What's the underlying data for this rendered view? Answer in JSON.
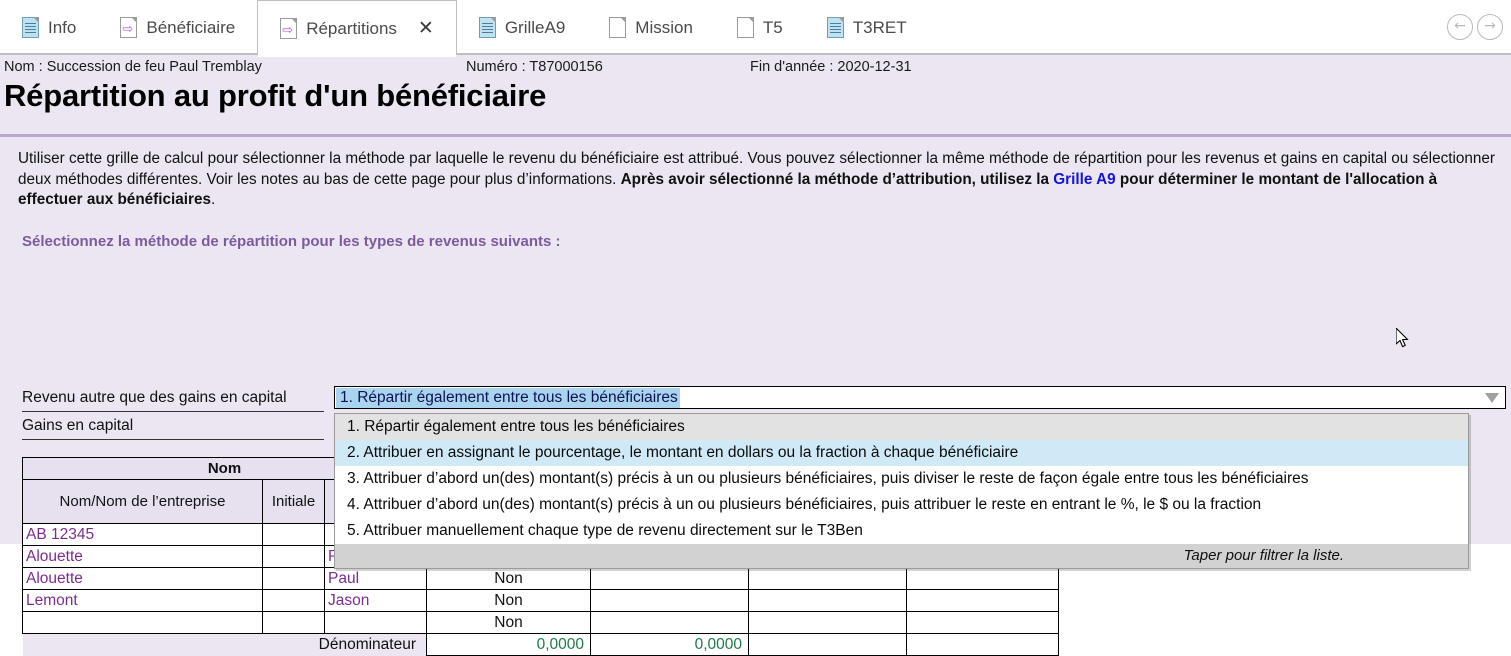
{
  "tabs": [
    {
      "label": "Info",
      "icon": "document-blue-icon",
      "active": false,
      "closable": false
    },
    {
      "label": "Bénéficiaire",
      "icon": "document-arrow-icon",
      "active": false,
      "closable": false
    },
    {
      "label": "Répartitions",
      "icon": "document-arrow-icon",
      "active": true,
      "closable": true,
      "close_label": "✕"
    },
    {
      "label": "GrilleA9",
      "icon": "document-blue-icon",
      "active": false,
      "closable": false
    },
    {
      "label": "Mission",
      "icon": "document-plain-icon",
      "active": false,
      "closable": false
    },
    {
      "label": "T5",
      "icon": "document-plain-icon",
      "active": false,
      "closable": false
    },
    {
      "label": "T3RET",
      "icon": "document-blue-icon",
      "active": false,
      "closable": false
    }
  ],
  "nav": {
    "back_label": "←",
    "forward_label": "→"
  },
  "infobar": {
    "nom": "Nom : Succession de feu Paul Tremblay",
    "numero": "Numéro : T87000156",
    "fin_annee": "Fin d'année : 2020-12-31"
  },
  "page_title": "Répartition au profit d'un bénéficiaire",
  "paragraph": {
    "part1": "Utiliser cette grille de calcul pour sélectionner la méthode par laquelle le revenu du bénéficiaire est attribué. Vous pouvez sélectionner la même méthode de répartition pour les revenus et gains en capital ou sélectionner deux méthodes différentes. Voir les notes au bas de cette page pour plus d’informations. ",
    "bold1": "Après avoir sélectionné la méthode d’attribution, utilisez la ",
    "link": "Grille A9",
    "bold2": " pour déterminer le montant de l'allocation à effectuer aux bénéficiaires",
    "end": "."
  },
  "section_heading": "Sélectionnez la méthode de répartition pour les types de revenus suivants :",
  "fields": [
    {
      "label": "Revenu autre que des gains en capital"
    },
    {
      "label": "Gains en capital"
    }
  ],
  "combo": {
    "value": "1. Répartir également entre tous les bénéficiaires",
    "arrow": "dropdown-arrow"
  },
  "dropdown": {
    "options": [
      {
        "label": "1. Répartir également entre tous les bénéficiaires",
        "state": "selected"
      },
      {
        "label": "2. Attribuer en assignant le pourcentage, le montant en dollars ou la fraction à chaque bénéficiaire",
        "state": "hover"
      },
      {
        "label": "3. Attribuer d’abord un(des) montant(s) précis à un ou plusieurs bénéficiaires, puis diviser le reste de façon égale entre tous les bénéficiaires",
        "state": "normal"
      },
      {
        "label": "4. Attribuer d’abord un(des) montant(s) précis à un ou plusieurs bénéficiaires, puis attribuer le reste en entrant le %, le $ ou la fraction",
        "state": "normal"
      },
      {
        "label": "5. Attribuer manuellement chaque type de revenu directement sur le T3Ben",
        "state": "normal"
      }
    ],
    "footer": "Taper pour filtrer la liste."
  },
  "table": {
    "group_header": "Nom",
    "columns": [
      "Nom/Nom de l’entreprise",
      "Initiale",
      "",
      "",
      "",
      "",
      ""
    ],
    "rows": [
      {
        "nom": "AB 12345",
        "initiale": "",
        "prenom": "",
        "non": "",
        "c5": "",
        "c6": "",
        "c7": ""
      },
      {
        "nom": "Alouette",
        "initiale": "",
        "prenom": "P",
        "non": "",
        "c5": "",
        "c6": "",
        "c7": ""
      },
      {
        "nom": "Alouette",
        "initiale": "",
        "prenom": "Paul",
        "non": "Non",
        "c5": "",
        "c6": "",
        "c7": ""
      },
      {
        "nom": "Lemont",
        "initiale": "",
        "prenom": "Jason",
        "non": "Non",
        "c5": "",
        "c6": "",
        "c7": ""
      },
      {
        "nom": "",
        "initiale": "",
        "prenom": "",
        "non": "Non",
        "c5": "",
        "c6": "",
        "c7": ""
      }
    ],
    "footer": {
      "label": "Dénominateur",
      "value1": "0,0000",
      "value2": "0,0000",
      "value3": "",
      "value4": ""
    }
  }
}
